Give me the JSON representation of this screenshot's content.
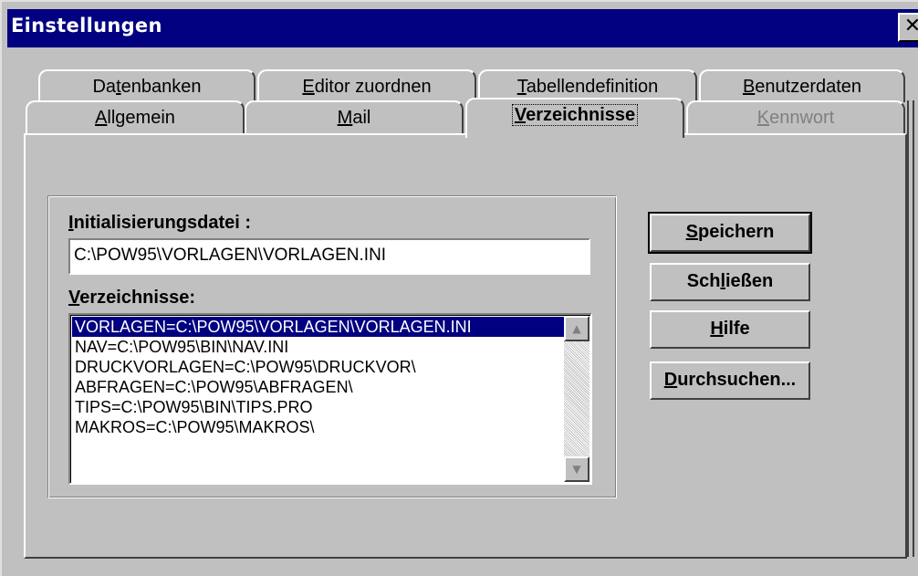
{
  "window": {
    "title": "Einstellungen",
    "close_glyph": "✕"
  },
  "tabs_back": [
    {
      "pre": "Da",
      "key": "t",
      "post": "enbanken"
    },
    {
      "pre": "",
      "key": "E",
      "post": "ditor zuordnen"
    },
    {
      "pre": "",
      "key": "T",
      "post": "abellendefinition"
    },
    {
      "pre": "",
      "key": "B",
      "post": "enutzerdaten"
    }
  ],
  "tabs_front": [
    {
      "pre": "",
      "key": "A",
      "post": "llgemein"
    },
    {
      "pre": "",
      "key": "M",
      "post": "ail"
    },
    {
      "pre": "",
      "key": "V",
      "post": "erzeichnisse"
    },
    {
      "pre": "",
      "key": "K",
      "post": "ennwort"
    }
  ],
  "form": {
    "ini_label_key": "I",
    "ini_label_rest": "nitialisierungsdatei :",
    "ini_value": "C:\\POW95\\VORLAGEN\\VORLAGEN.INI",
    "list_label_key": "V",
    "list_label_rest": "erzeichnisse:",
    "list_items": [
      "VORLAGEN=C:\\POW95\\VORLAGEN\\VORLAGEN.INI",
      "NAV=C:\\POW95\\BIN\\NAV.INI",
      "DRUCKVORLAGEN=C:\\POW95\\DRUCKVOR\\",
      "ABFRAGEN=C:\\POW95\\ABFRAGEN\\",
      "TIPS=C:\\POW95\\BIN\\TIPS.PRO",
      "MAKROS=C:\\POW95\\MAKROS\\"
    ]
  },
  "buttons": {
    "save": {
      "pre": "",
      "key": "S",
      "post": "peichern"
    },
    "close": {
      "pre": "Sch",
      "key": "l",
      "post": "ießen"
    },
    "help": {
      "pre": "",
      "key": "H",
      "post": "ilfe"
    },
    "browse": {
      "pre": "",
      "key": "D",
      "post": "urchsuchen..."
    }
  },
  "colors": {
    "titlebar": "#000080",
    "face": "#c0c0c0",
    "selection": "#000080"
  }
}
